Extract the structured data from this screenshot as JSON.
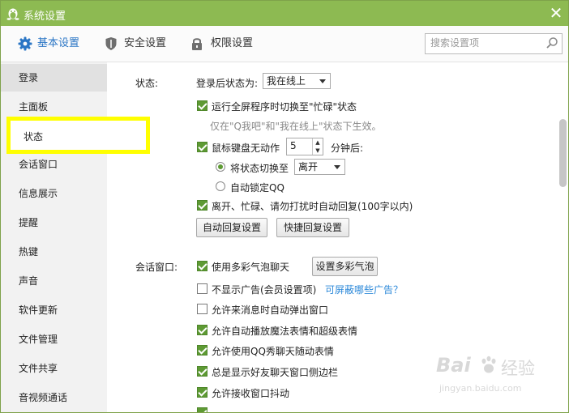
{
  "window": {
    "title": "系统设置",
    "close_glyph": "✕"
  },
  "toolbar": {
    "tabs": [
      {
        "label": "基本设置",
        "icon": "gear-icon",
        "active": true
      },
      {
        "label": "安全设置",
        "icon": "shield-icon",
        "active": false
      },
      {
        "label": "权限设置",
        "icon": "lock-icon",
        "active": false
      }
    ],
    "search_placeholder": "搜索设置项"
  },
  "sidebar": {
    "items": [
      {
        "label": "登录"
      },
      {
        "label": "主面板"
      },
      {
        "label": "状态"
      },
      {
        "label": "会话窗口"
      },
      {
        "label": "信息展示"
      },
      {
        "label": "提醒"
      },
      {
        "label": "热键"
      },
      {
        "label": "声音"
      },
      {
        "label": "软件更新"
      },
      {
        "label": "文件管理"
      },
      {
        "label": "文件共享"
      },
      {
        "label": "音视频通话"
      }
    ],
    "active_index": 0,
    "highlighted_label": "状态"
  },
  "status_section": {
    "heading": "状态:",
    "login_status_label": "登录后状态为:",
    "login_status_value": "我在线上",
    "fullscreen_busy": {
      "label": "运行全屏程序时切换至\"忙碌\"状态",
      "checked": true
    },
    "fullscreen_hint": "仅在\"Q我吧\"和\"我在线上\"状态下生效。",
    "idle": {
      "label": "鼠标键盘无动作",
      "checked": true,
      "minutes": "5",
      "suffix": "分钟后:"
    },
    "switch_status": {
      "label": "将状态切换至",
      "selected": true,
      "value": "离开"
    },
    "auto_lock": {
      "label": "自动锁定QQ",
      "selected": false
    },
    "auto_reply": {
      "label": "离开、忙碌、请勿打扰时自动回复(100字以内)",
      "checked": true
    },
    "auto_reply_button": "自动回复设置",
    "quick_reply_button": "快捷回复设置"
  },
  "session_section": {
    "heading": "会话窗口:",
    "bubble": {
      "label": "使用多彩气泡聊天",
      "checked": true,
      "button": "设置多彩气泡"
    },
    "no_ads": {
      "label": "不显示广告(会员设置项)",
      "checked": false,
      "link": "可屏蔽哪些广告？"
    },
    "options": [
      {
        "label": "允许来消息时自动弹出窗口",
        "checked": false
      },
      {
        "label": "允许自动播放魔法表情和超级表情",
        "checked": true
      },
      {
        "label": "允许使用QQ秀聊天随动表情",
        "checked": true
      },
      {
        "label": "总是显示好友聊天窗口侧边栏",
        "checked": true
      },
      {
        "label": "允许接收窗口抖动",
        "checked": true
      }
    ]
  },
  "watermark": {
    "brand": "Bai",
    "brand_tail": "经验",
    "url": "jingyan.baidu.com"
  },
  "colors": {
    "titlebar": "#8dba52",
    "accent": "#2b76c5",
    "check": "#5e9a34",
    "highlight": "#ffff00",
    "link": "#2b88d9"
  }
}
